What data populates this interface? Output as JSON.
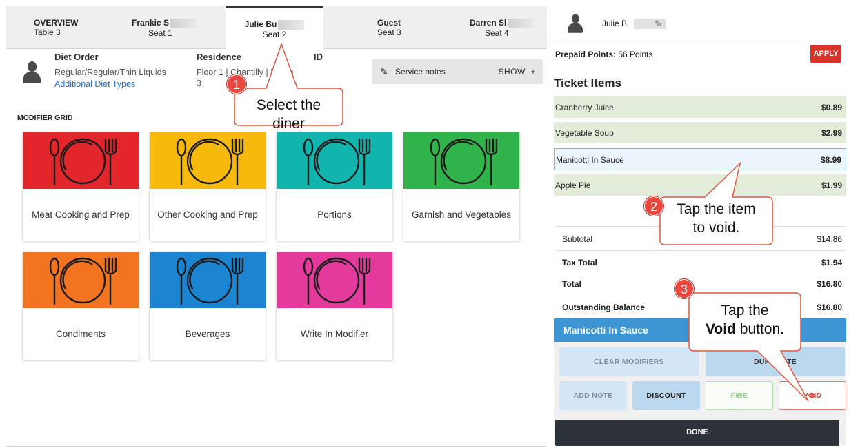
{
  "seat_tabs": [
    {
      "name": "OVERVIEW",
      "sub": "Table 3"
    },
    {
      "name": "Frankie S",
      "sub": "Seat 1"
    },
    {
      "name": "Julie Bu",
      "sub": "Seat 2"
    },
    {
      "name": "Guest",
      "sub": "Seat 3"
    },
    {
      "name": "Darren Sl",
      "sub": "Seat 4"
    }
  ],
  "diner_info": {
    "diet_order_label": "Diet Order",
    "diet_order_value": "Regular/Regular/Thin Liquids",
    "additional_diet_link": "Additional Diet Types",
    "residence_label": "Residence",
    "residence_value": "Floor 1 | Chantilly | Room",
    "residence_value_line2": "3",
    "id_label": "ID"
  },
  "service_notes": {
    "label": "Service notes",
    "toggle": "SHOW",
    "toggle_icon": "+"
  },
  "modifier_grid": {
    "title": "MODIFIER GRID",
    "tiles": [
      {
        "label": "Meat Cooking and Prep",
        "color": "#e3262b"
      },
      {
        "label": "Other Cooking and Prep",
        "color": "#f7b90c"
      },
      {
        "label": "Portions",
        "color": "#11b5ad"
      },
      {
        "label": "Garnish and Vegetables",
        "color": "#2fb34a"
      },
      {
        "label": "Condiments",
        "color": "#f37420"
      },
      {
        "label": "Beverages",
        "color": "#1c85d1"
      },
      {
        "label": "Write In Modifier",
        "color": "#e43a9b"
      }
    ]
  },
  "right_panel": {
    "diner_name": "Julie B",
    "prepaid_label": "Prepaid Points:",
    "prepaid_value": "56 Points",
    "apply_label": "APPLY",
    "ticket_title": "Ticket Items",
    "items": [
      {
        "name": "Cranberry Juice",
        "price": "$0.89"
      },
      {
        "name": "Vegetable Soup",
        "price": "$2.99"
      },
      {
        "name": "Manicotti In Sauce",
        "price": "$8.99"
      },
      {
        "name": "Apple Pie",
        "price": "$1.99"
      }
    ],
    "subtotal_label": "Subtotal",
    "subtotal_value": "$14.86",
    "tax_label": "Tax Total",
    "tax_value": "$1.94",
    "total_label": "Total",
    "total_value": "$16.80",
    "balance_label": "Outstanding Balance",
    "balance_value": "$16.80",
    "selected_item": "Manicotti In Sauce",
    "actions": {
      "clear_modifiers": "CLEAR MODIFIERS",
      "duplicate": "DUPLICATE",
      "add_note": "ADD NOTE",
      "discount": "DISCOUNT",
      "fire": "FIRE",
      "void": "VOID",
      "done": "DONE"
    }
  },
  "callouts": [
    {
      "number": "1",
      "text_line1": "Select the",
      "text_line2": "diner"
    },
    {
      "number": "2",
      "text_line1": "Tap the item",
      "text_line2": "to void."
    },
    {
      "number": "3",
      "text_line1": "Tap the",
      "text_line2_bold": "Void",
      "text_line2_rest": " button."
    }
  ],
  "colors": {
    "accent_blue": "#3d95d3",
    "apply_red": "#d9332a",
    "callout_badge": "#e9463d",
    "callout_border": "#e2573f",
    "ticket_item_bg": "#e2ecd8",
    "done_bg": "#2c313a"
  }
}
